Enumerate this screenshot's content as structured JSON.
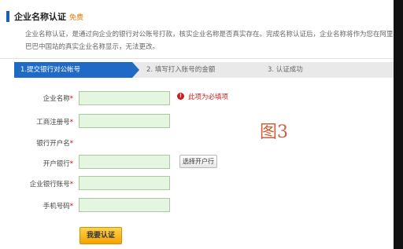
{
  "header": {
    "title": "企业名称认证",
    "badge": "免费",
    "description": "企业名称认证，是通过向企业的银行对公账号打款，核实企业名称是否真实存在。完成名称认证后，企业名称将作为您在阿里巴巴中国站的真实企业名称显示，无法更改。"
  },
  "steps": [
    {
      "label": "1.提交银行对公帐号",
      "active": true
    },
    {
      "label": "2. 填写打入账号的金额",
      "active": false
    },
    {
      "label": "3. 认证成功",
      "active": false
    }
  ],
  "form": {
    "fields": [
      {
        "label": "企业名称",
        "required_mark": "*"
      },
      {
        "label": "工商注册号",
        "required_mark": "*"
      },
      {
        "label": "银行开户名",
        "required_mark": "*"
      },
      {
        "label": "开户银行",
        "required_mark": "*"
      },
      {
        "label": "企业银行账号",
        "required_mark": "*"
      },
      {
        "label": "手机号码",
        "required_mark": "*"
      }
    ],
    "error_icon": "!",
    "error_text": "此项为必填项",
    "select_bank_label": "选择开户行",
    "submit_label": "我要认证"
  },
  "overlay": {
    "figure_label": "图3"
  },
  "colors": {
    "accent": "#1e6ac4",
    "error": "#cc1d1d",
    "submit": "#f5a300",
    "input_bg": "#e4f5e0"
  }
}
